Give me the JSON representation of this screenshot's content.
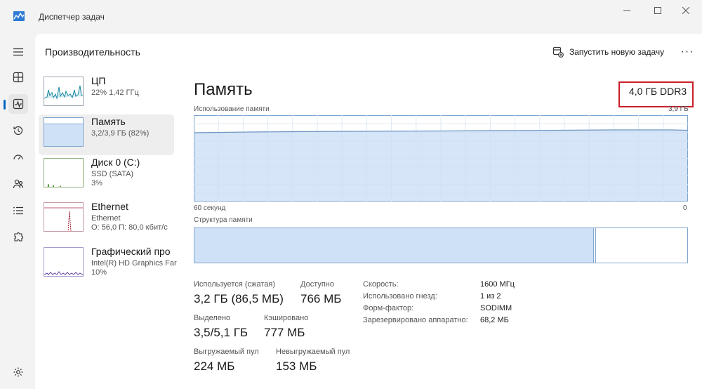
{
  "window": {
    "title": "Диспетчер задач"
  },
  "header": {
    "title": "Производительность",
    "run_task": "Запустить новую задачу",
    "more": "···"
  },
  "devices": [
    {
      "name": "ЦП",
      "line1": "22% 1,42 ГГц",
      "line2": ""
    },
    {
      "name": "Память",
      "line1": "3,2/3,9 ГБ (82%)",
      "line2": ""
    },
    {
      "name": "Диск 0 (C:)",
      "line1": "SSD (SATA)",
      "line2": "3%"
    },
    {
      "name": "Ethernet",
      "line1": "Ethernet",
      "line2": "О: 56,0 П: 80,0 кбит/с"
    },
    {
      "name": "Графический про",
      "line1": "Intel(R) HD Graphics Far",
      "line2": "10%"
    }
  ],
  "memory": {
    "title": "Память",
    "type": "4,0 ГБ DDR3",
    "usage_label": "Использование памяти",
    "usage_max": "3,9 ГБ",
    "x_start": "60 секунд",
    "x_end": "0",
    "structure_label": "Структура памяти",
    "structure_used_fraction": 0.81,
    "usage_level_fraction": 0.82
  },
  "stats": {
    "in_use_label": "Используется (сжатая)",
    "in_use": "3,2 ГБ (86,5 МБ)",
    "available_label": "Доступно",
    "available": "766 МБ",
    "committed_label": "Выделено",
    "committed": "3,5/5,1 ГБ",
    "cached_label": "Кэшировано",
    "cached": "777 МБ",
    "paged_label": "Выгружаемый пул",
    "paged": "224 МБ",
    "nonpaged_label": "Невыгружаемый пул",
    "nonpaged": "153 МБ"
  },
  "specs": {
    "speed_label": "Скорость:",
    "speed": "1600 МГц",
    "slots_label": "Использовано гнезд:",
    "slots": "1 из 2",
    "form_label": "Форм-фактор:",
    "form": "SODIMM",
    "reserved_label": "Зарезервировано аппаратно:",
    "reserved": "68,2 МБ"
  },
  "colors": {
    "memory_fill": "#cfe1f7",
    "memory_line": "#7fa6cf",
    "highlight": "#c8202a",
    "cpu": "#1788a0",
    "disk": "#4e8a2c",
    "ethernet": "#a3283b",
    "gpu": "#6040a8"
  }
}
